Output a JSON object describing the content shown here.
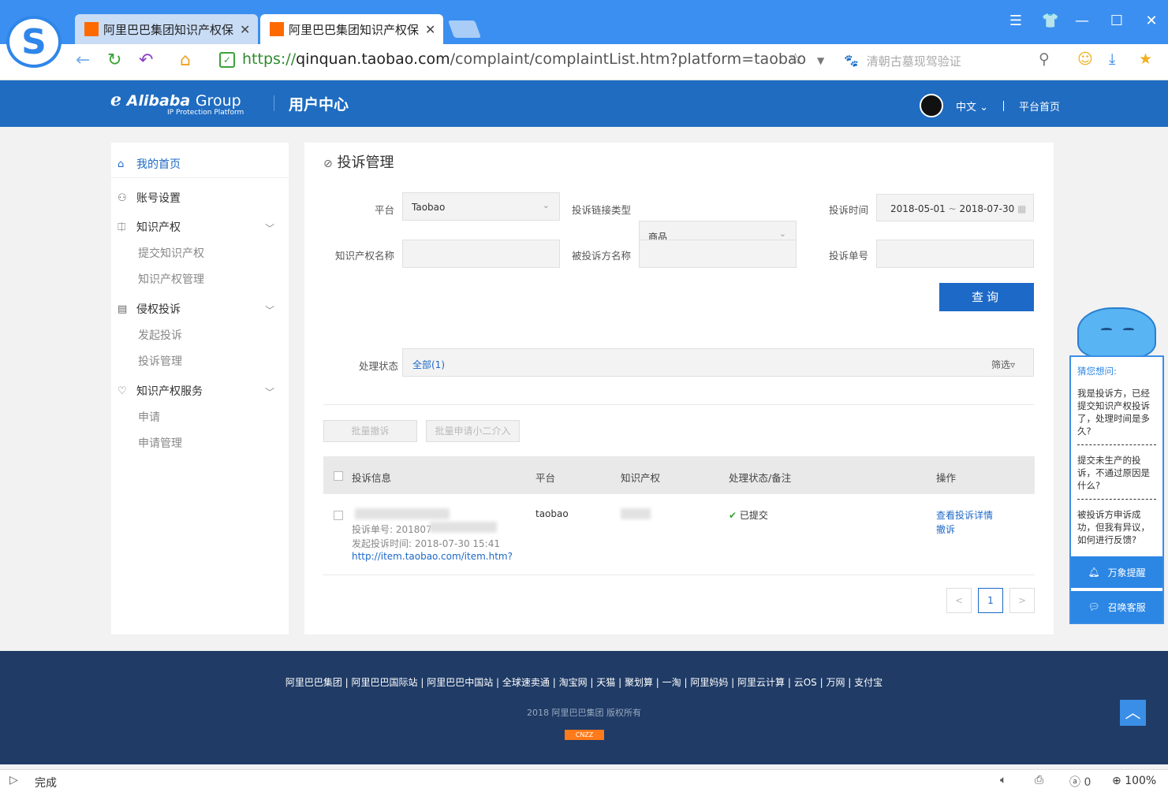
{
  "browser": {
    "tabs": [
      {
        "title": "阿里巴巴集团知识产权保"
      },
      {
        "title": "阿里巴巴集团知识产权保"
      }
    ],
    "url": {
      "scheme": "https://",
      "host": "qinquan.taobao.com",
      "path": "/complaint/complaintList.htm?platform=taobao"
    },
    "search_placeholder": "清朝古墓现驾验证",
    "status": "完成",
    "zoom": "100%",
    "counter": "0"
  },
  "header": {
    "brand": "Alibaba",
    "brand_group": "Group",
    "brand_sub": "IP Protection Platform",
    "section": "用户中心",
    "lang": "中文",
    "home": "平台首页"
  },
  "sidebar": {
    "home": "我的首页",
    "account": "账号设置",
    "ip": "知识产权",
    "ip_submit": "提交知识产权",
    "ip_manage": "知识产权管理",
    "complaint": "侵权投诉",
    "complaint_new": "发起投诉",
    "complaint_manage": "投诉管理",
    "service": "知识产权服务",
    "service_apply": "申请",
    "service_manage": "申请管理"
  },
  "main": {
    "title": "投诉管理",
    "filters": {
      "platform_label": "平台",
      "platform_value": "Taobao",
      "link_type_label": "投诉链接类型",
      "link_type_value": "商品",
      "time_label": "投诉时间",
      "time_from": "2018-05-01",
      "time_sep": "~",
      "time_to": "2018-07-30",
      "ip_name_label": "知识产权名称",
      "respondent_label": "被投诉方名称",
      "number_label": "投诉单号"
    },
    "query_button": "查询",
    "status_label": "处理状态",
    "status_all": "全部(1)",
    "filter_label": "筛选",
    "batch_withdraw": "批量撤诉",
    "batch_apply": "批量申请小二介入",
    "table": {
      "headers": [
        "投诉信息",
        "平台",
        "知识产权",
        "处理状态/备注",
        "操作"
      ],
      "row": {
        "number": "投诉单号: 201807",
        "time": "发起投诉时间: 2018-07-30 15:41",
        "link": "http://item.taobao.com/item.htm?",
        "platform": "taobao",
        "status": "已提交",
        "action_detail": "查看投诉详情",
        "action_withdraw": "撤诉"
      }
    },
    "pagination": {
      "prev": "<",
      "current": "1",
      "next": ">"
    }
  },
  "assistant": {
    "heading": "猜您想问:",
    "questions": [
      "我是投诉方，已经提交知识产权投诉了，处理时间是多久?",
      "提交未生产的投诉，不通过原因是什么?",
      "被投诉方申诉成功，但我有异议，如何进行反馈?"
    ],
    "remind": "万象提醒",
    "service": "召唤客服"
  },
  "footer": {
    "links": [
      "阿里巴巴集团",
      "阿里巴巴国际站",
      "阿里巴巴中国站",
      "全球速卖通",
      "淘宝网",
      "天猫",
      "聚划算",
      "一淘",
      "阿里妈妈",
      "阿里云计算",
      "云OS",
      "万网",
      "支付宝"
    ],
    "copyright": "2018 阿里巴巴集团 版权所有",
    "badge": "CNZZ"
  },
  "colors": {
    "primary": "#1d69c7",
    "header": "#1f6cc1",
    "footer": "#1f3b66",
    "browser": "#3b8ff0"
  }
}
